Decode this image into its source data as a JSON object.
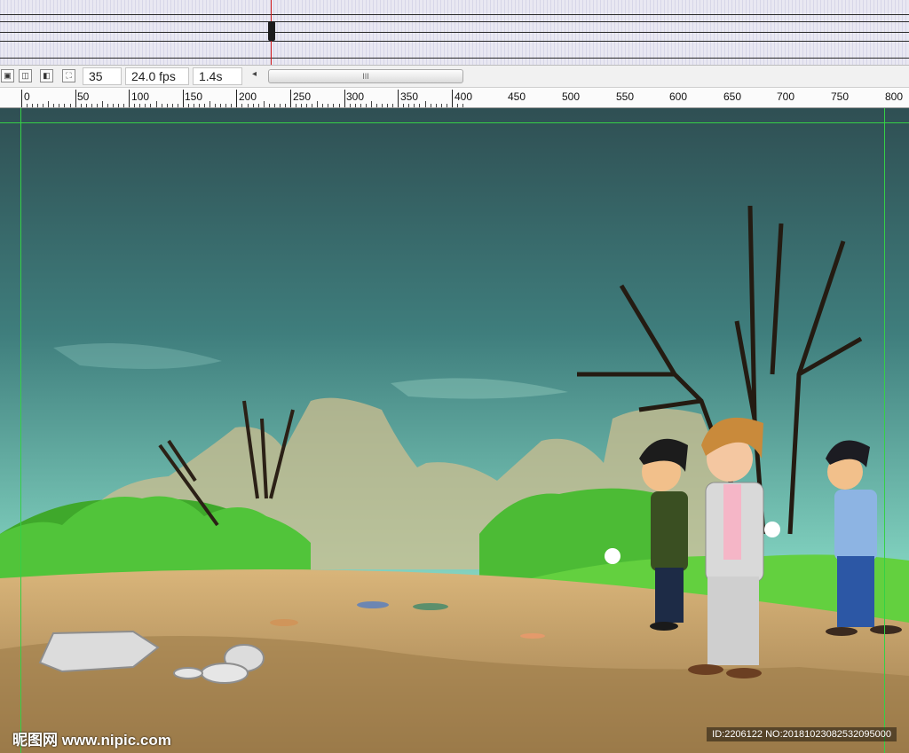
{
  "toolbar": {
    "frame": "35",
    "fps": "24.0 fps",
    "time": "1.4s",
    "scroll_grip": "III",
    "scroll_arrow": "◂"
  },
  "ruler": {
    "labels": [
      "0",
      "50",
      "100",
      "150",
      "200",
      "250",
      "300",
      "350",
      "400",
      "450",
      "500",
      "550",
      "600",
      "650",
      "700",
      "750",
      "800"
    ]
  },
  "watermark": {
    "site": "昵图网 www.nipic.com",
    "id": "ID:2206122 NO:20181023082532095000"
  },
  "colors": {
    "playhead": "#d21b1b",
    "guide": "#35d046",
    "sky_top": "#2f4f53",
    "sky_bottom": "#86d8c5",
    "grass": "#4fbf35",
    "ground": "#c9a36a"
  }
}
